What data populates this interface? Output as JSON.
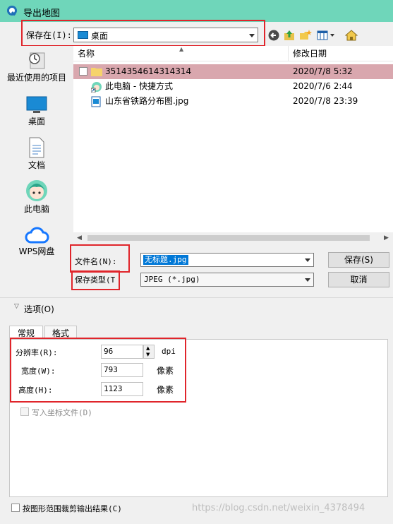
{
  "window": {
    "title": "导出地图"
  },
  "save_in": {
    "label": "保存在(I):",
    "value": "桌面"
  },
  "sidebar": {
    "items": [
      {
        "label": "最近使用的项目",
        "icon": "recent-items-icon"
      },
      {
        "label": "桌面",
        "icon": "desktop-icon"
      },
      {
        "label": "文档",
        "icon": "documents-icon"
      },
      {
        "label": "此电脑",
        "icon": "this-pc-icon"
      },
      {
        "label": "WPS网盘",
        "icon": "wps-cloud-icon"
      }
    ]
  },
  "file_list": {
    "columns": {
      "name": "名称",
      "modified": "修改日期"
    },
    "rows": [
      {
        "name": "3514354614314314",
        "date": "2020/7/8 5:32",
        "icon": "folder-icon",
        "selected": true
      },
      {
        "name": "此电脑 - 快捷方式",
        "date": "2020/7/6 2:44",
        "icon": "shortcut-icon",
        "selected": false
      },
      {
        "name": "山东省铁路分布图.jpg",
        "date": "2020/7/8 23:39",
        "icon": "image-file-icon",
        "selected": false
      }
    ]
  },
  "filename": {
    "label": "文件名(N):",
    "value": "无标题.jpg"
  },
  "filetype": {
    "label": "保存类型(T",
    "value": "JPEG (*.jpg)"
  },
  "buttons": {
    "save": "保存(S)",
    "cancel": "取消"
  },
  "options": {
    "label": "选项(O)"
  },
  "tabs": [
    {
      "label": "常规"
    },
    {
      "label": "格式"
    }
  ],
  "settings": {
    "resolution": {
      "label": "分辨率(R):",
      "value": "96",
      "unit": "dpi"
    },
    "width": {
      "label": "宽度(W):",
      "value": "793",
      "unit": "像素"
    },
    "height": {
      "label": "高度(H):",
      "value": "1123",
      "unit": "像素"
    },
    "write_coords": {
      "label": "写入坐标文件(D)"
    }
  },
  "clip": {
    "label": "按图形范围裁剪输出结果(C)"
  },
  "watermark": "https://blog.csdn.net/weixin_4378494",
  "colors": {
    "titlebar": "#6fd6ba",
    "highlight_box": "#e0252b",
    "selected_row": "#d9a7ae",
    "accent": "#0078d7"
  }
}
